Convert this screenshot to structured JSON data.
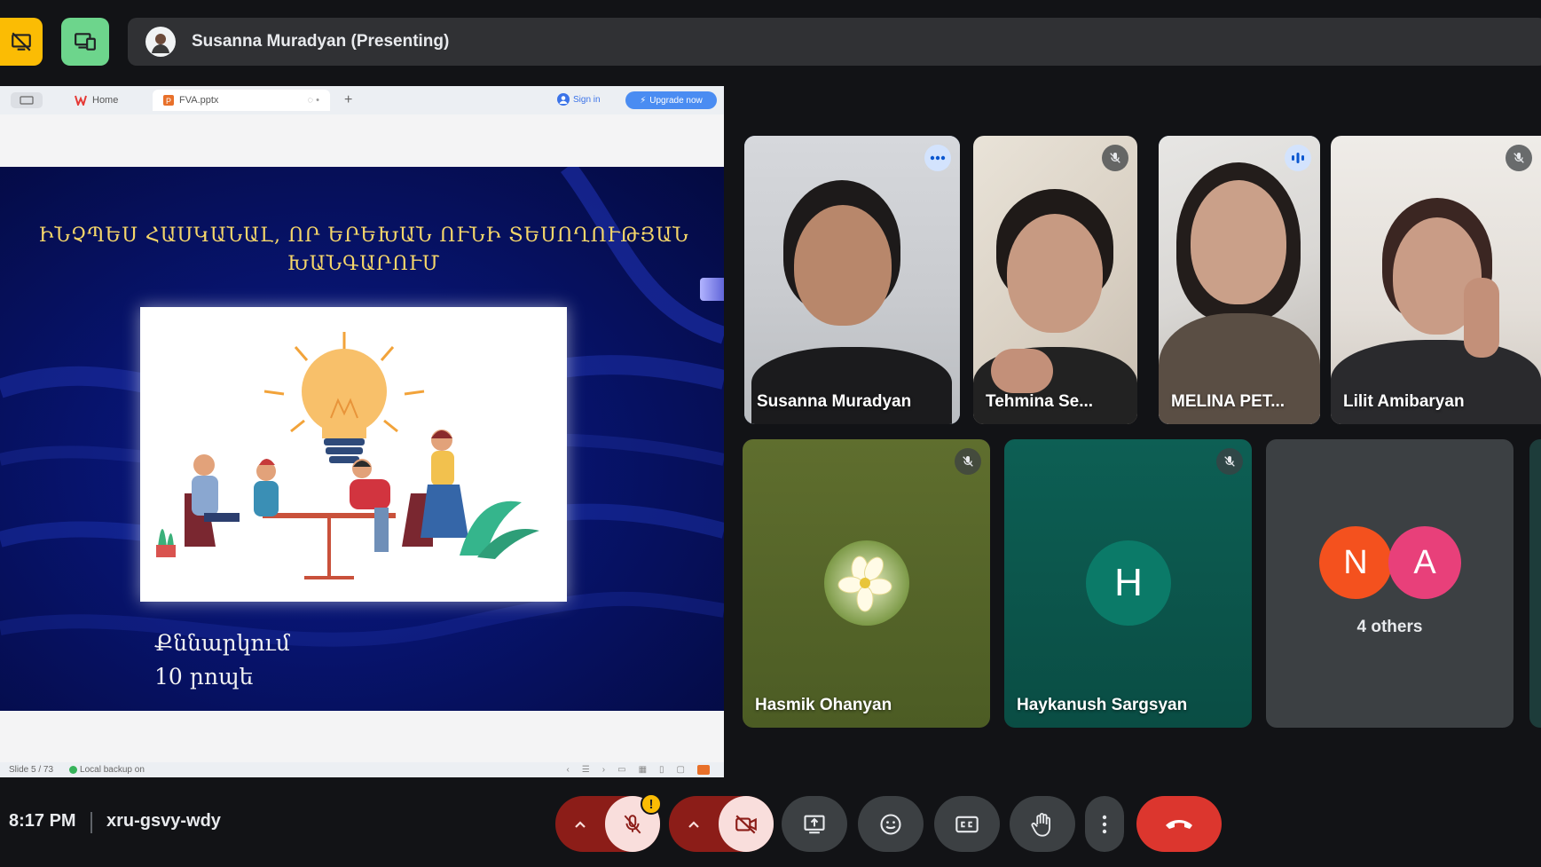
{
  "presenter": {
    "label": "Susanna Muradyan (Presenting)"
  },
  "browser": {
    "tabs": [
      {
        "label": "Home"
      },
      {
        "label": "FVA.pptx"
      }
    ],
    "sign_in": "Sign in",
    "upgrade": "Upgrade now"
  },
  "slide": {
    "title_line1": "ԻՆՉՊԵՍ ՀԱՍԿԱՆԱԼ, ՈՐ ԵՐԵԽԱՆ ՈՒՆԻ ՏԵՍՈՂՈՒԹՅԱՆ",
    "title_line2": "ԽԱՆԳԱՐՈՒՄ",
    "caption_line1": "Քննարկում",
    "caption_line2": "10 րոպե"
  },
  "status_bar": {
    "slide_count": "Slide 5 / 73",
    "backup": "Local backup on"
  },
  "participants": [
    {
      "name": "Susanna Muradyan",
      "status": "more-options"
    },
    {
      "name": "Tehmina Se...",
      "status": "muted"
    },
    {
      "name": "MELINA PET...",
      "status": "speaking"
    },
    {
      "name": "Lilit Amibaryan",
      "status": "muted"
    },
    {
      "name": "Hasmik Ohanyan",
      "status": "muted"
    },
    {
      "name": "Haykanush Sargsyan",
      "status": "muted",
      "initial": "H"
    }
  ],
  "others": {
    "initials": [
      "N",
      "A"
    ],
    "label": "4 others"
  },
  "bottom_bar": {
    "time": "8:17 PM",
    "meeting_code": "xru-gsvy-wdy",
    "warning": "!"
  },
  "colors": {
    "accent_speaking": "#a8c7fa",
    "present_button": "#fbbc04",
    "layout_button": "#6dd58c",
    "hangup": "#dc362e",
    "avatar_n": "#f4511e",
    "avatar_a": "#e8407a",
    "avatar_h": "#0b7a68"
  }
}
